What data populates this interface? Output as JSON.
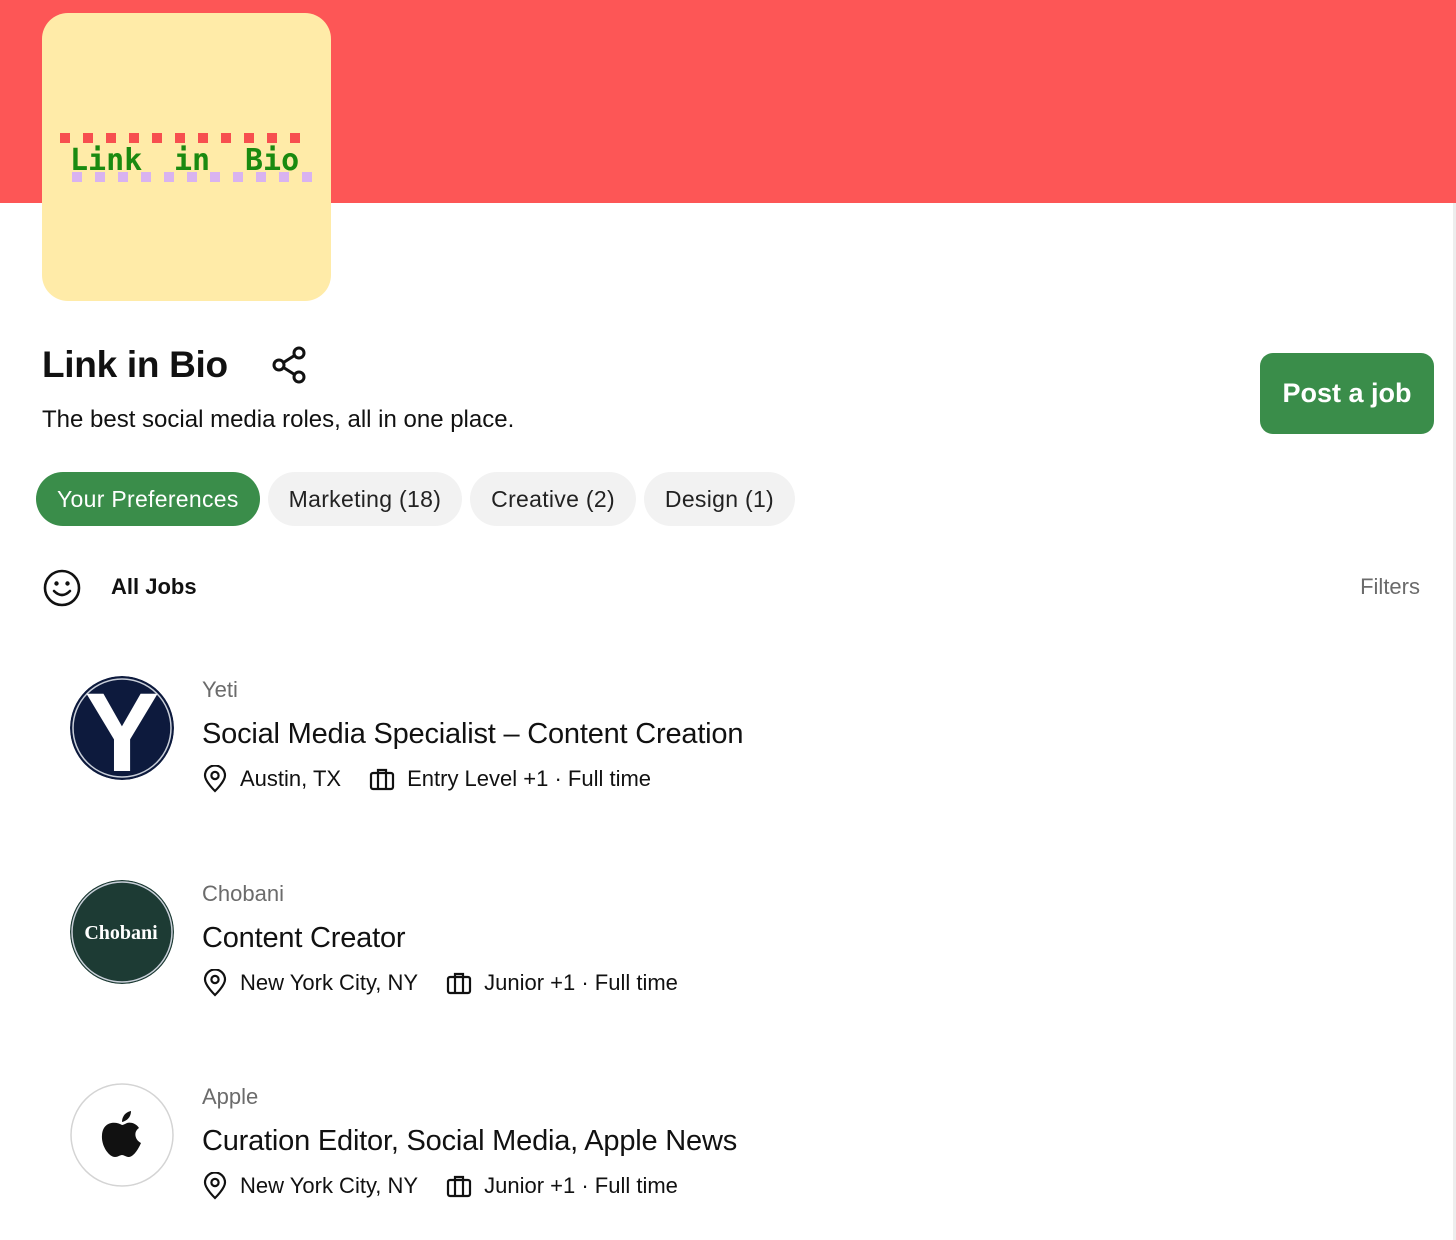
{
  "theme": {
    "banner_color": "#fd5656",
    "accent_green": "#3a8d4a",
    "logo_bg": "#ffeba8"
  },
  "board": {
    "logo_words": [
      "Link",
      "in",
      "Bio"
    ],
    "title": "Link in Bio",
    "tagline": "The best social media roles, all in one place.",
    "post_job_label": "Post a job"
  },
  "chips": [
    {
      "label": "Your Preferences",
      "active": true
    },
    {
      "label": "Marketing (18)",
      "active": false
    },
    {
      "label": "Creative (2)",
      "active": false
    },
    {
      "label": "Design (1)",
      "active": false
    }
  ],
  "jobs_header": {
    "label": "All Jobs",
    "filters_label": "Filters"
  },
  "jobs": [
    {
      "company": "Yeti",
      "logo_letter": "Y",
      "title": "Social Media Specialist – Content Creation",
      "location": "Austin, TX",
      "level": "Entry Level +1 · Full time"
    },
    {
      "company": "Chobani",
      "logo_text": "Chobani",
      "title": "Content Creator",
      "location": "New York City, NY",
      "level": "Junior +1 · Full time"
    },
    {
      "company": "Apple",
      "title": "Curation Editor, Social Media, Apple News",
      "location": "New York City, NY",
      "level": "Junior +1 · Full time"
    }
  ]
}
